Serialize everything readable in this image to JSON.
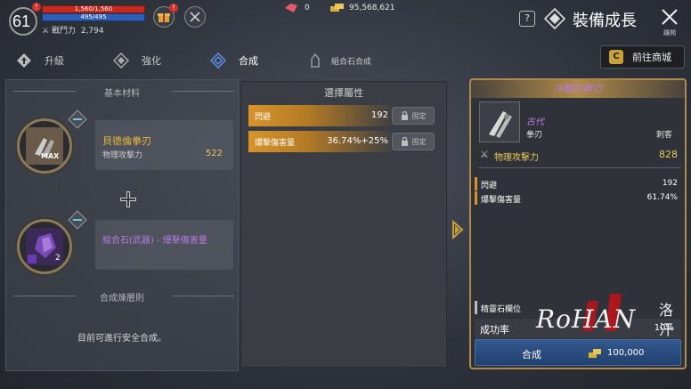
{
  "player": {
    "level": "61",
    "hp_text": "1,560/1,560",
    "mp_text": "495/495",
    "power_label": "戰鬥力",
    "power_value": "2,794"
  },
  "currency": {
    "gem": "0",
    "gold": "95,568,621"
  },
  "header": {
    "title": "裝備成長",
    "close_label": "離開",
    "help_label": "?"
  },
  "tabs": [
    {
      "label": "升級"
    },
    {
      "label": "強化"
    },
    {
      "label": "合成"
    },
    {
      "label": "組合石合成"
    }
  ],
  "shop_button": {
    "label": "前往商城",
    "icon_letter": "C"
  },
  "left": {
    "base_title": "基本材料",
    "material1": {
      "name": "貝德倫拳刃",
      "stat": "物理攻擊力",
      "value": "522",
      "badge": "MAX"
    },
    "material2": {
      "name": "組合石(武器) - 爆擊傷害量",
      "count": "2"
    },
    "rules_title": "合成煉層則",
    "safe_text": "目前可進行安全合成。"
  },
  "middle": {
    "title": "選擇屬性",
    "attrs": [
      {
        "name": "閃避",
        "value": "192",
        "lock": "固定"
      },
      {
        "name": "爆擊傷害量",
        "value": "36.74%+25%",
        "lock": "固定"
      }
    ]
  },
  "right": {
    "item_name": "冷酷的拳刃",
    "grade": "古代",
    "type": "拳刃",
    "class": "刺客",
    "main_stat_name": "物理攻擊力",
    "main_stat_value": "828",
    "attrs": [
      {
        "name": "閃避",
        "value": "192"
      },
      {
        "name": "爆擊傷害量",
        "value": "61.74%"
      }
    ],
    "spirit_slot": "精靈石欄位",
    "rate_label": "成功率",
    "rate_value": "10%",
    "synth_label": "合成",
    "synth_cost": "100,000"
  },
  "colors": {
    "accent_gold": "#d8942a",
    "epic_purple": "#b57be0",
    "stat_gold": "#e8c85a",
    "button_blue": "#2b4c80"
  }
}
